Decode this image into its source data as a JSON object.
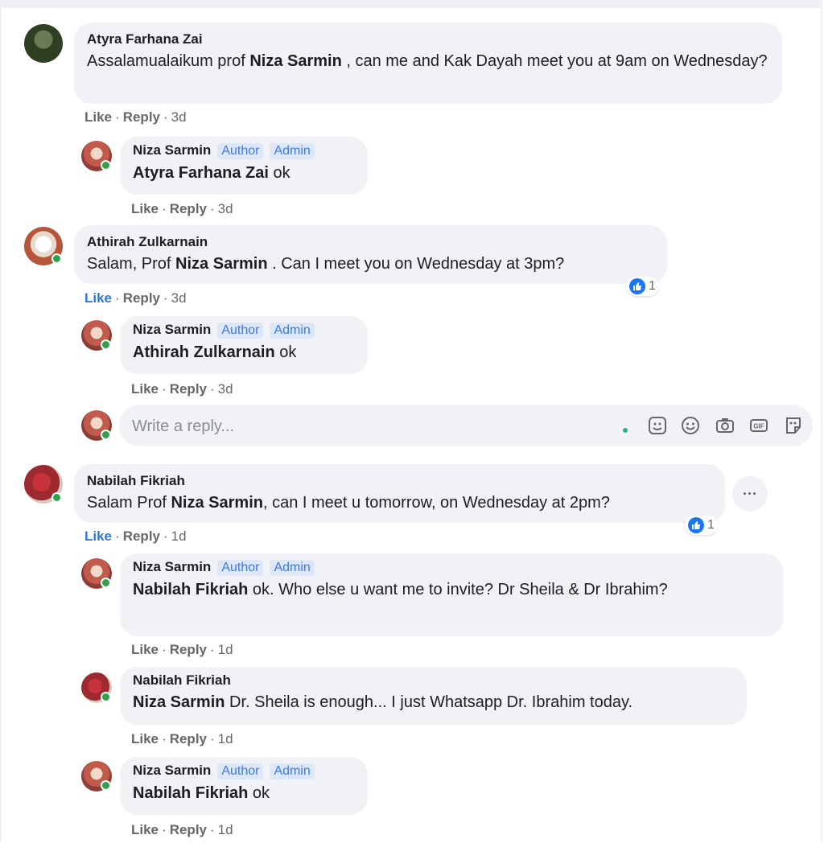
{
  "colors": {
    "bubble": "#f0f2f5",
    "badge_text": "#3b7be0",
    "like_blue": "#2d77e3",
    "meta_gray": "#65676b"
  },
  "actions": {
    "like": "Like",
    "reply": "Reply",
    "separator": "·"
  },
  "badges": {
    "author": "Author",
    "admin": "Admin"
  },
  "comments": [
    {
      "author": "Atyra Farhana Zai",
      "text_1": "Assalamualaikum prof ",
      "mention": "Niza Sarmin",
      "text_2": " , can me and Kak Dayah meet you at 9am on Wednesday?",
      "time": "3d",
      "replies": [
        {
          "author": "Niza Sarmin",
          "mention": "Atyra Farhana Zai",
          "text": " ok",
          "time": "3d"
        }
      ]
    },
    {
      "author": "Athirah Zulkarnain",
      "text_1": "Salam, Prof ",
      "mention": "Niza Sarmin",
      "text_2": " . Can I meet you on Wednesday at 3pm?",
      "time": "3d",
      "reaction_count": "1",
      "liked": true,
      "replies": [
        {
          "author": "Niza Sarmin",
          "mention": "Athirah Zulkarnain",
          "text": " ok",
          "time": "3d"
        }
      ]
    },
    {
      "author": "Nabilah Fikriah",
      "text_1": "Salam Prof ",
      "mention": "Niza Sarmin",
      "text_2": ", can I meet u tomorrow, on Wednesday at 2pm?",
      "time": "1d",
      "reaction_count": "1",
      "liked": true,
      "replies": [
        {
          "author": "Niza Sarmin",
          "mention": "Nabilah Fikriah",
          "text": " ok. Who else u want me to invite? Dr Sheila & Dr Ibrahim?",
          "time": "1d"
        },
        {
          "author": "Nabilah Fikriah",
          "mention": "Niza Sarmin",
          "text": " Dr. Sheila is enough... I just Whatsapp Dr. Ibrahim today.",
          "time": "1d"
        },
        {
          "author": "Niza Sarmin",
          "mention": "Nabilah Fikriah",
          "text": " ok",
          "time": "1d"
        }
      ]
    }
  ],
  "reply_box": {
    "placeholder": "Write a reply...",
    "icons": [
      "avatar-sticker-icon",
      "emoji-icon",
      "camera-icon",
      "gif-icon",
      "sticker-icon"
    ]
  },
  "more_button": "···"
}
